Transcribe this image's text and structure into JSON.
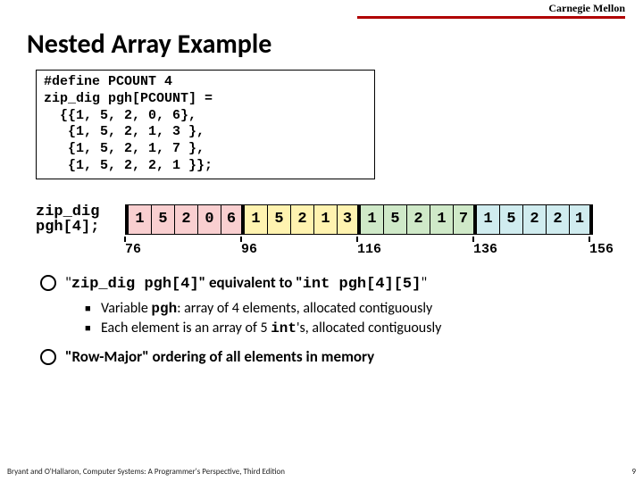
{
  "header": {
    "logo": "Carnegie Mellon"
  },
  "title": "Nested Array Example",
  "code": "#define PCOUNT 4\nzip_dig pgh[PCOUNT] =\n  {{1, 5, 2, 0, 6},\n   {1, 5, 2, 1, 3 },\n   {1, 5, 2, 1, 7 },\n   {1, 5, 2, 2, 1 }};",
  "array": {
    "label_line1": "zip_dig",
    "label_line2": "pgh[4];",
    "cells": [
      "1",
      "5",
      "2",
      "0",
      "6",
      "1",
      "5",
      "2",
      "1",
      "3",
      "1",
      "5",
      "2",
      "1",
      "7",
      "1",
      "5",
      "2",
      "2",
      "1"
    ],
    "ticks": [
      "76",
      "96",
      "116",
      "136",
      "156"
    ]
  },
  "bullets": {
    "b1_pre": "\"",
    "b1_code1": "zip_dig pgh[4]",
    "b1_mid": "\" equivalent to \"",
    "b1_code2": "int pgh[4][5]",
    "b1_post": "\"",
    "s1_a": "Variable ",
    "s1_code": "pgh",
    "s1_b": ": array of 4 elements, allocated contiguously",
    "s2_a": "Each element is an array of 5 ",
    "s2_code": "int",
    "s2_b": "'s, allocated contiguously",
    "b2": "\"Row-Major\" ordering of all elements in memory"
  },
  "footer": {
    "left": "Bryant and O'Hallaron, Computer Systems: A Programmer's Perspective, Third Edition",
    "right": "9"
  }
}
